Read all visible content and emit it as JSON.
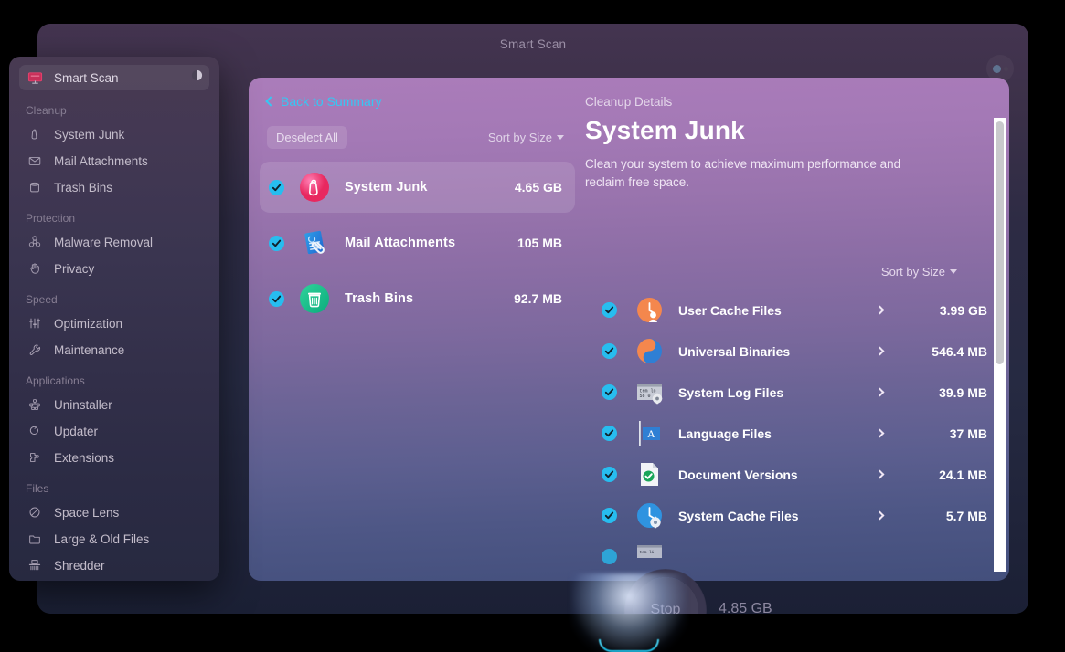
{
  "window": {
    "title": "Smart Scan",
    "traffic_lights": [
      "close-button",
      "minimize-button",
      "maximize-button"
    ],
    "right_button": "menu-button"
  },
  "sidebar": {
    "active_item": "Smart Scan",
    "top_item": {
      "label": "Smart Scan",
      "icon": "monitor-icon",
      "trailing_icon": "half-circle-icon"
    },
    "groups": [
      {
        "title": "Cleanup",
        "items": [
          {
            "label": "System Junk",
            "icon": "broom-icon"
          },
          {
            "label": "Mail Attachments",
            "icon": "envelope-icon"
          },
          {
            "label": "Trash Bins",
            "icon": "trash-icon"
          }
        ]
      },
      {
        "title": "Protection",
        "items": [
          {
            "label": "Malware Removal",
            "icon": "biohazard-icon"
          },
          {
            "label": "Privacy",
            "icon": "hand-icon"
          }
        ]
      },
      {
        "title": "Speed",
        "items": [
          {
            "label": "Optimization",
            "icon": "sliders-icon"
          },
          {
            "label": "Maintenance",
            "icon": "wrench-icon"
          }
        ]
      },
      {
        "title": "Applications",
        "items": [
          {
            "label": "Uninstaller",
            "icon": "apps-grid-icon"
          },
          {
            "label": "Updater",
            "icon": "refresh-icon"
          },
          {
            "label": "Extensions",
            "icon": "puzzle-icon"
          }
        ]
      },
      {
        "title": "Files",
        "items": [
          {
            "label": "Space Lens",
            "icon": "lens-icon"
          },
          {
            "label": "Large & Old Files",
            "icon": "folder-icon"
          },
          {
            "label": "Shredder",
            "icon": "shredder-icon"
          }
        ]
      }
    ]
  },
  "panel": {
    "back_link": "Back to Summary",
    "section_label": "Cleanup Details",
    "left": {
      "deselect_label": "Deselect All",
      "sort_label": "Sort by Size",
      "categories": [
        {
          "name": "System Junk",
          "size": "4.65 GB",
          "checked": true,
          "selected": true,
          "icon": "broom-circle-icon"
        },
        {
          "name": "Mail Attachments",
          "size": "105 MB",
          "checked": true,
          "selected": false,
          "icon": "mail-attachment-icon"
        },
        {
          "name": "Trash Bins",
          "size": "92.7 MB",
          "checked": true,
          "selected": false,
          "icon": "trash-circle-icon"
        }
      ]
    },
    "right": {
      "title": "System Junk",
      "description": "Clean your system to achieve maximum performance and reclaim free space.",
      "sort_label": "Sort by Size",
      "items": [
        {
          "name": "User Cache Files",
          "size": "3.99 GB",
          "checked": true,
          "icon": "user-cache-icon"
        },
        {
          "name": "Universal Binaries",
          "size": "546.4 MB",
          "checked": true,
          "icon": "universal-binaries-icon"
        },
        {
          "name": "System Log Files",
          "size": "39.9 MB",
          "checked": true,
          "icon": "log-file-icon"
        },
        {
          "name": "Language Files",
          "size": "37 MB",
          "checked": true,
          "icon": "language-file-icon"
        },
        {
          "name": "Document Versions",
          "size": "24.1 MB",
          "checked": true,
          "icon": "document-versions-icon"
        },
        {
          "name": "System Cache Files",
          "size": "5.7 MB",
          "checked": true,
          "icon": "system-cache-icon"
        }
      ]
    }
  },
  "bottom": {
    "stop_label": "Stop",
    "total_size": "4.85 GB"
  },
  "colors": {
    "accent_checkbox": "#27bdef",
    "link": "#36c7f3",
    "panel_top": "#ab7cba",
    "panel_bottom": "#434f7c"
  }
}
